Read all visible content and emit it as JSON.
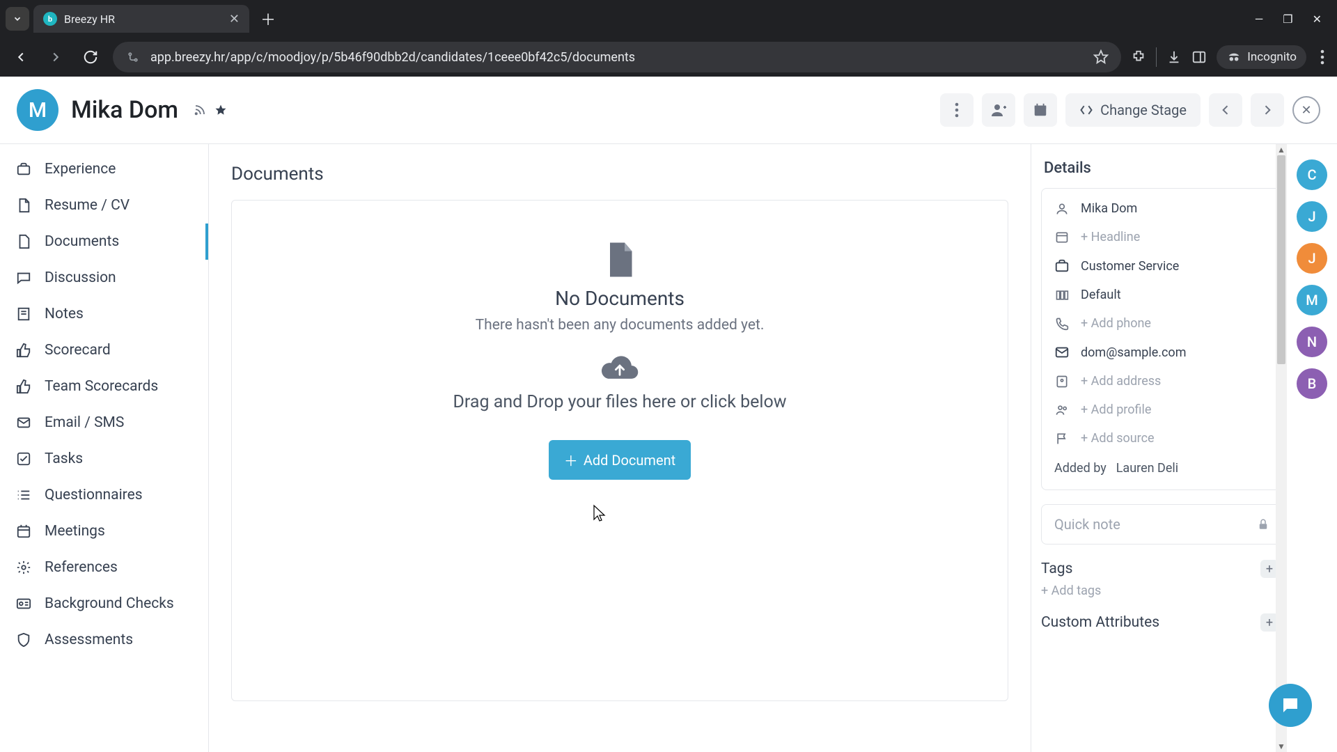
{
  "browser": {
    "tab_title": "Breezy HR",
    "url": "app.breezy.hr/app/c/moodjoy/p/5b46f90dbb2d/candidates/1ceee0bf42c5/documents",
    "incognito_label": "Incognito"
  },
  "header": {
    "avatar_letter": "M",
    "candidate_name": "Mika Dom",
    "change_stage_label": "Change Stage"
  },
  "sidebar": {
    "items": [
      {
        "icon": "briefcase",
        "label": "Experience"
      },
      {
        "icon": "file",
        "label": "Resume / CV"
      },
      {
        "icon": "file-blank",
        "label": "Documents",
        "active": true
      },
      {
        "icon": "chat",
        "label": "Discussion"
      },
      {
        "icon": "note",
        "label": "Notes"
      },
      {
        "icon": "thumbs",
        "label": "Scorecard"
      },
      {
        "icon": "thumbs",
        "label": "Team Scorecards"
      },
      {
        "icon": "mail",
        "label": "Email / SMS"
      },
      {
        "icon": "check",
        "label": "Tasks"
      },
      {
        "icon": "list",
        "label": "Questionnaires"
      },
      {
        "icon": "calendar",
        "label": "Meetings"
      },
      {
        "icon": "gear",
        "label": "References"
      },
      {
        "icon": "id",
        "label": "Background Checks"
      },
      {
        "icon": "shield",
        "label": "Assessments"
      }
    ]
  },
  "main": {
    "title": "Documents",
    "empty_title": "No Documents",
    "empty_sub": "There hasn't been any documents added yet.",
    "drag_text": "Drag and Drop your files here or click below",
    "add_button": "Add Document"
  },
  "details": {
    "title": "Details",
    "rows": [
      {
        "icon": "user",
        "text": "Mika Dom",
        "muted": false
      },
      {
        "icon": "headline",
        "text": "+ Headline",
        "muted": true
      },
      {
        "icon": "briefcase",
        "text": "Customer Service",
        "muted": false
      },
      {
        "icon": "pipeline",
        "text": "Default",
        "muted": false
      },
      {
        "icon": "phone",
        "text": "+ Add phone",
        "muted": true
      },
      {
        "icon": "mail",
        "text": "dom@sample.com",
        "muted": false
      },
      {
        "icon": "address",
        "text": "+ Add address",
        "muted": true
      },
      {
        "icon": "profile",
        "text": "+ Add profile",
        "muted": true
      },
      {
        "icon": "flag",
        "text": "+ Add source",
        "muted": true
      }
    ],
    "added_by_label": "Added by",
    "added_by_value": "Lauren Deli",
    "quick_note_placeholder": "Quick note",
    "tags_title": "Tags",
    "add_tags": "+ Add tags",
    "custom_attrs_title": "Custom Attributes"
  },
  "people": [
    {
      "letter": "C",
      "color": "#3aa9d4"
    },
    {
      "letter": "J",
      "color": "#3aa9d4"
    },
    {
      "letter": "J",
      "color": "#f08c3a"
    },
    {
      "letter": "M",
      "color": "#3aa9d4"
    },
    {
      "letter": "N",
      "color": "#8c5fb2"
    },
    {
      "letter": "B",
      "color": "#8c5fb2"
    }
  ]
}
